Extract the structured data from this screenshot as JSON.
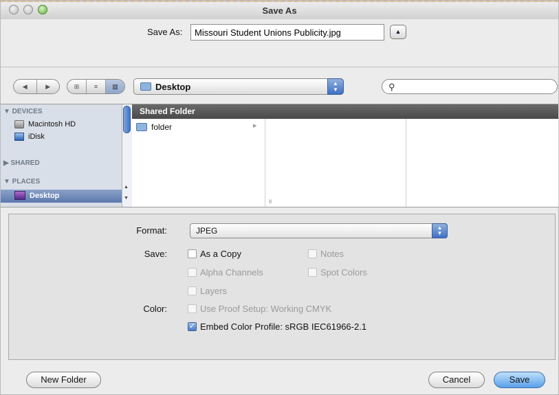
{
  "window": {
    "title": "Save As"
  },
  "save_as": {
    "label": "Save As:",
    "filename": "Missouri Student Unions Publicity.jpg"
  },
  "toolbar": {
    "nav_back": "◀",
    "nav_forward": "▶",
    "view_icon": "⊞",
    "view_list": "≡",
    "view_columns": "▥",
    "location": "Desktop",
    "search_placeholder": "",
    "search_icon": "🔍"
  },
  "sidebar": {
    "devices_header": "▼ DEVICES",
    "devices": [
      {
        "label": "Macintosh HD"
      },
      {
        "label": "iDisk"
      }
    ],
    "shared_header": "▶ SHARED",
    "places_header": "▼ PLACES",
    "places": [
      {
        "label": "Desktop"
      }
    ]
  },
  "browser": {
    "column_header": "Shared Folder",
    "items": [
      {
        "label": "folder"
      }
    ]
  },
  "options": {
    "format_label": "Format:",
    "format_value": "JPEG",
    "save_label": "Save:",
    "color_label": "Color:",
    "as_copy": "As a Copy",
    "notes": "Notes",
    "alpha_channels": "Alpha Channels",
    "spot_colors": "Spot Colors",
    "layers": "Layers",
    "use_proof_setup": "Use Proof Setup:  Working CMYK",
    "embed_color_profile": "Embed Color Profile:  sRGB IEC61966-2.1"
  },
  "buttons": {
    "new_folder": "New Folder",
    "cancel": "Cancel",
    "save": "Save"
  }
}
